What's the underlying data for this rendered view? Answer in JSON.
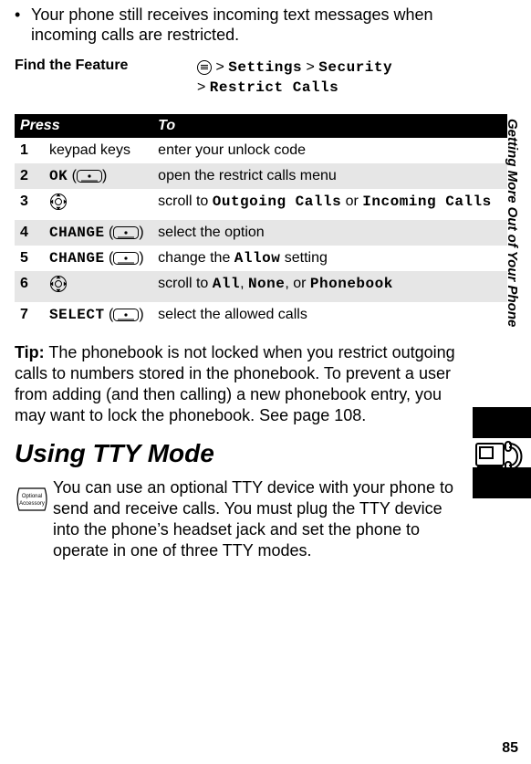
{
  "bullet": {
    "text": "Your phone still receives incoming text messages when incoming calls are restricted."
  },
  "find": {
    "label": "Find the Feature",
    "path_line1_prefix": "> ",
    "path_line1_a": "Settings",
    "path_line1_mid": " > ",
    "path_line1_b": "Security",
    "path_line2_prefix": "> ",
    "path_line2_a": "Restrict Calls"
  },
  "table": {
    "head_press": "Press",
    "head_to": "To",
    "rows": [
      {
        "n": "1",
        "press_plain": "keypad keys",
        "to": "enter your unlock code"
      },
      {
        "n": "2",
        "press_code": "OK",
        "softkey": true,
        "to": "open the restrict calls menu"
      },
      {
        "n": "3",
        "nav": true,
        "to_pre": "scroll to ",
        "to_code": "Outgoing Calls",
        "to_mid": " or ",
        "to_code2": "Incoming Calls"
      },
      {
        "n": "4",
        "press_code": "CHANGE",
        "softkey": true,
        "to": "select the option"
      },
      {
        "n": "5",
        "press_code": "CHANGE",
        "softkey": true,
        "to_pre": "change the ",
        "to_code": "Allow",
        "to_post": " setting"
      },
      {
        "n": "6",
        "nav": true,
        "to_pre": "scroll to ",
        "to_code": "All",
        "to_mid": ", ",
        "to_code2": "None",
        "to_mid2": ", or ",
        "to_code3": "Phonebook"
      },
      {
        "n": "7",
        "press_code": "SELECT",
        "softkey": true,
        "to": "select the allowed calls"
      }
    ]
  },
  "tip": {
    "label": "Tip:",
    "text": " The phonebook is not locked when you restrict outgoing calls to numbers stored in the phonebook. To prevent a user from adding (and then calling) a new phonebook entry, you may want to lock the phonebook. See page 108."
  },
  "heading": "Using TTY Mode",
  "tty": {
    "text": "You can use an optional TTY device with your phone to send and receive calls. You must plug the TTY device into the phone’s headset jack and set the phone to operate in one of three TTY modes."
  },
  "side_label": "Getting More Out of Your Phone",
  "page_number": "85",
  "accessory_label_line1": "Optional",
  "accessory_label_line2": "Accessory"
}
